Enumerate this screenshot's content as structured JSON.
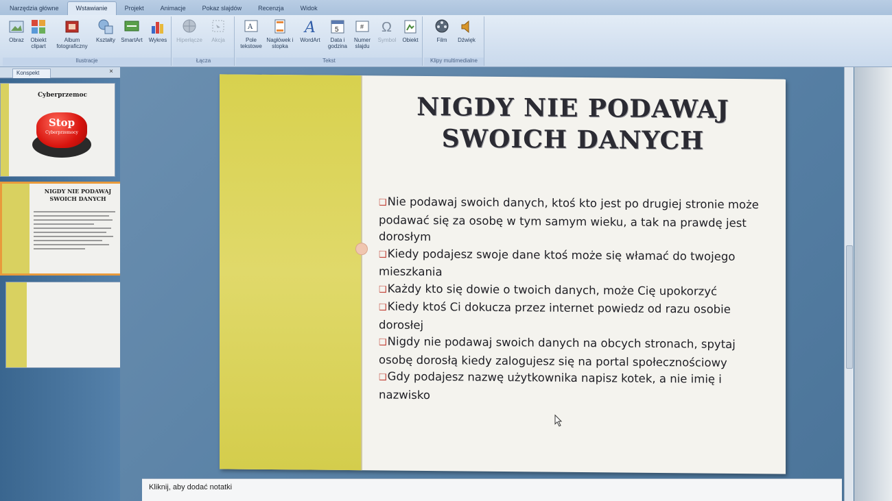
{
  "ribbon": {
    "tabs": [
      "Narzędzia główne",
      "Wstawianie",
      "Projekt",
      "Animacje",
      "Pokaz slajdów",
      "Recenzja",
      "Widok"
    ],
    "active_tab": "Wstawianie",
    "groups": {
      "ilustracje": {
        "label": "Ilustracje",
        "buttons": [
          "Obraz",
          "Obiekt clipart",
          "Album fotograficzny",
          "Kształty",
          "SmartArt",
          "Wykres"
        ]
      },
      "lacza": {
        "label": "Łącza",
        "buttons": [
          "Hiperłącze",
          "Akcja"
        ]
      },
      "tekst": {
        "label": "Tekst",
        "buttons": [
          "Pole tekstowe",
          "Nagłówek i stopka",
          "WordArt",
          "Data i godzina",
          "Numer slajdu",
          "Symbol",
          "Obiekt"
        ]
      },
      "multimedia": {
        "label": "Klipy multimedialne",
        "buttons": [
          "Film",
          "Dźwięk"
        ]
      }
    }
  },
  "panel": {
    "tab_label": "Konspekt",
    "close": "×",
    "thumbnails": [
      {
        "title": "Cyberprzemoc",
        "button_text": "Stop",
        "button_sub": "Cyberprzemocy"
      },
      {
        "title": "NIGDY NIE PODAWAJ SWOICH DANYCH"
      },
      {
        "title": ""
      }
    ]
  },
  "slide": {
    "title": "Nigdy nie podawaj swoich danych",
    "bullets": [
      "Nie podawaj swoich danych, ktoś kto jest po drugiej stronie może podawać się za osobę w tym samym wieku, a tak na prawdę jest dorosłym",
      "Kiedy podajesz swoje dane ktoś może się włamać do twojego mieszkania",
      "Każdy kto się dowie o twoich danych, może Cię upokorzyć",
      "Kiedy ktoś Ci dokucza przez internet powiedz od razu osobie dorosłej",
      "Nigdy nie podawaj swoich danych na obcych stronach, spytaj osobę dorosłą kiedy zalogujesz się na portal społecznościowy",
      "Gdy podajesz nazwę użytkownika napisz kotek, a nie imię i nazwisko"
    ]
  },
  "notes": {
    "placeholder": "Kliknij, aby dodać notatki"
  },
  "colors": {
    "slide_bar": "#d8d14e",
    "bullet": "#c2443a",
    "selected_thumb": "#e89a3c"
  }
}
